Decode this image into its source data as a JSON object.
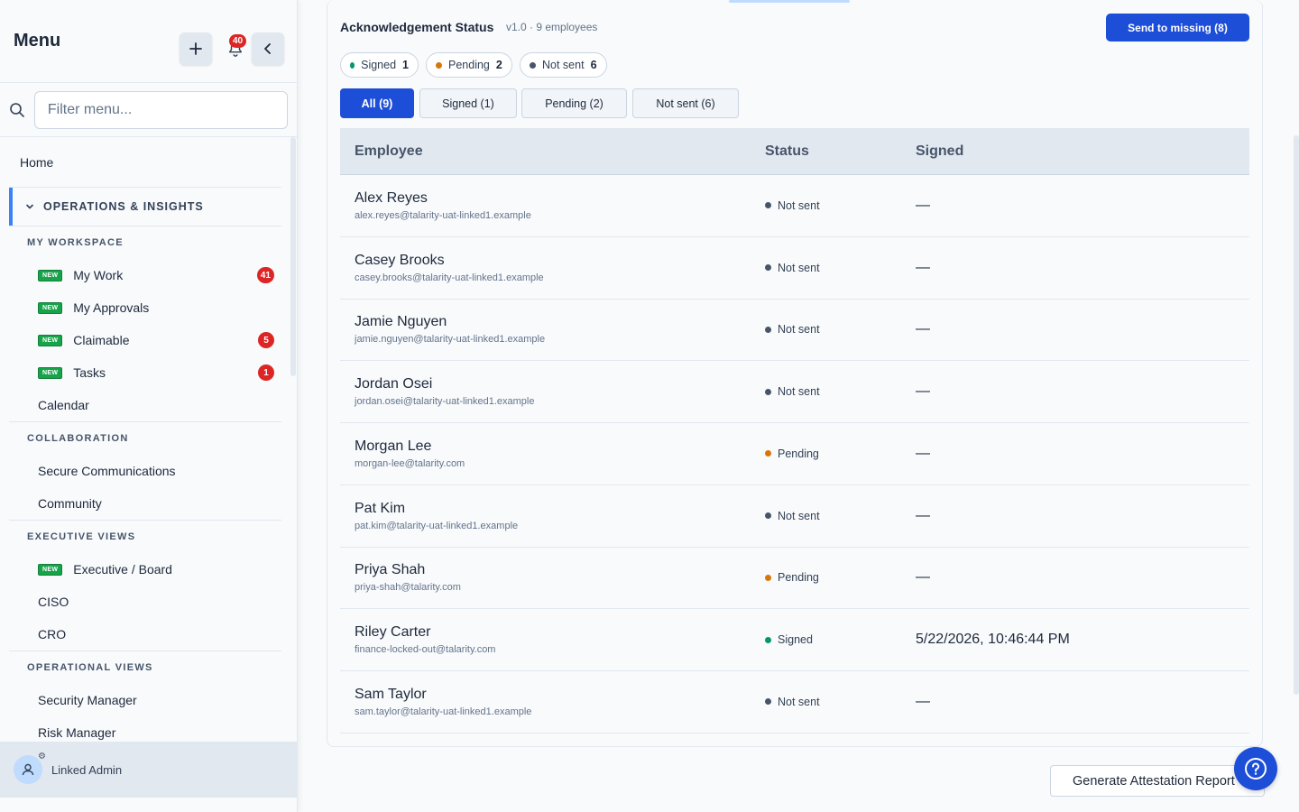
{
  "sidebar": {
    "title": "Menu",
    "bell_count": "40",
    "search_placeholder": "Filter menu...",
    "home": "Home",
    "section": "OPERATIONS & INSIGHTS",
    "groups": [
      {
        "title": "MY WORKSPACE",
        "items": [
          {
            "label": "My Work",
            "new": "NEW",
            "count": "41"
          },
          {
            "label": "My Approvals",
            "new": "NEW"
          },
          {
            "label": "Claimable",
            "new": "NEW",
            "count": "5"
          },
          {
            "label": "Tasks",
            "new": "NEW",
            "count": "1"
          },
          {
            "label": "Calendar"
          }
        ]
      },
      {
        "title": "COLLABORATION",
        "items": [
          {
            "label": "Secure Communications"
          },
          {
            "label": "Community"
          }
        ]
      },
      {
        "title": "EXECUTIVE VIEWS",
        "items": [
          {
            "label": "Executive / Board",
            "new": "NEW"
          },
          {
            "label": "CISO"
          },
          {
            "label": "CRO"
          }
        ]
      },
      {
        "title": "OPERATIONAL VIEWS",
        "items": [
          {
            "label": "Security Manager"
          },
          {
            "label": "Risk Manager"
          }
        ]
      }
    ],
    "user": "Linked Admin"
  },
  "card": {
    "title": "Acknowledgement Status",
    "subtitle": "v1.0 · 9 employees",
    "send_button": "Send to missing (8)",
    "chips": [
      {
        "label": "Signed",
        "count": "1",
        "color": "#059669"
      },
      {
        "label": "Pending",
        "count": "2",
        "color": "#d97706"
      },
      {
        "label": "Not sent",
        "count": "6",
        "color": "#475569"
      }
    ],
    "tabs": [
      "All (9)",
      "Signed (1)",
      "Pending (2)",
      "Not sent (6)"
    ],
    "columns": [
      "Employee",
      "Status",
      "Signed"
    ],
    "rows": [
      {
        "name": "Alex Reyes",
        "email": "alex.reyes@talarity-uat-linked1.example",
        "status": "Not sent",
        "signed": "—"
      },
      {
        "name": "Casey Brooks",
        "email": "casey.brooks@talarity-uat-linked1.example",
        "status": "Not sent",
        "signed": "—"
      },
      {
        "name": "Jamie Nguyen",
        "email": "jamie.nguyen@talarity-uat-linked1.example",
        "status": "Not sent",
        "signed": "—"
      },
      {
        "name": "Jordan Osei",
        "email": "jordan.osei@talarity-uat-linked1.example",
        "status": "Not sent",
        "signed": "—"
      },
      {
        "name": "Morgan Lee",
        "email": "morgan-lee@talarity.com",
        "status": "Pending",
        "signed": "—"
      },
      {
        "name": "Pat Kim",
        "email": "pat.kim@talarity-uat-linked1.example",
        "status": "Not sent",
        "signed": "—"
      },
      {
        "name": "Priya Shah",
        "email": "priya-shah@talarity.com",
        "status": "Pending",
        "signed": "—"
      },
      {
        "name": "Riley Carter",
        "email": "finance-locked-out@talarity.com",
        "status": "Signed",
        "signed": "5/22/2026, 10:46:44 PM"
      },
      {
        "name": "Sam Taylor",
        "email": "sam.taylor@talarity-uat-linked1.example",
        "status": "Not sent",
        "signed": "—"
      }
    ]
  },
  "footer": {
    "generate_button": "Generate Attestation Report"
  },
  "colors": {
    "accent": "#1d4ed8",
    "signed": "#059669",
    "pending": "#d97706",
    "not_sent": "#475569",
    "badge": "#dc2626",
    "new_tag": "#16a34a"
  }
}
